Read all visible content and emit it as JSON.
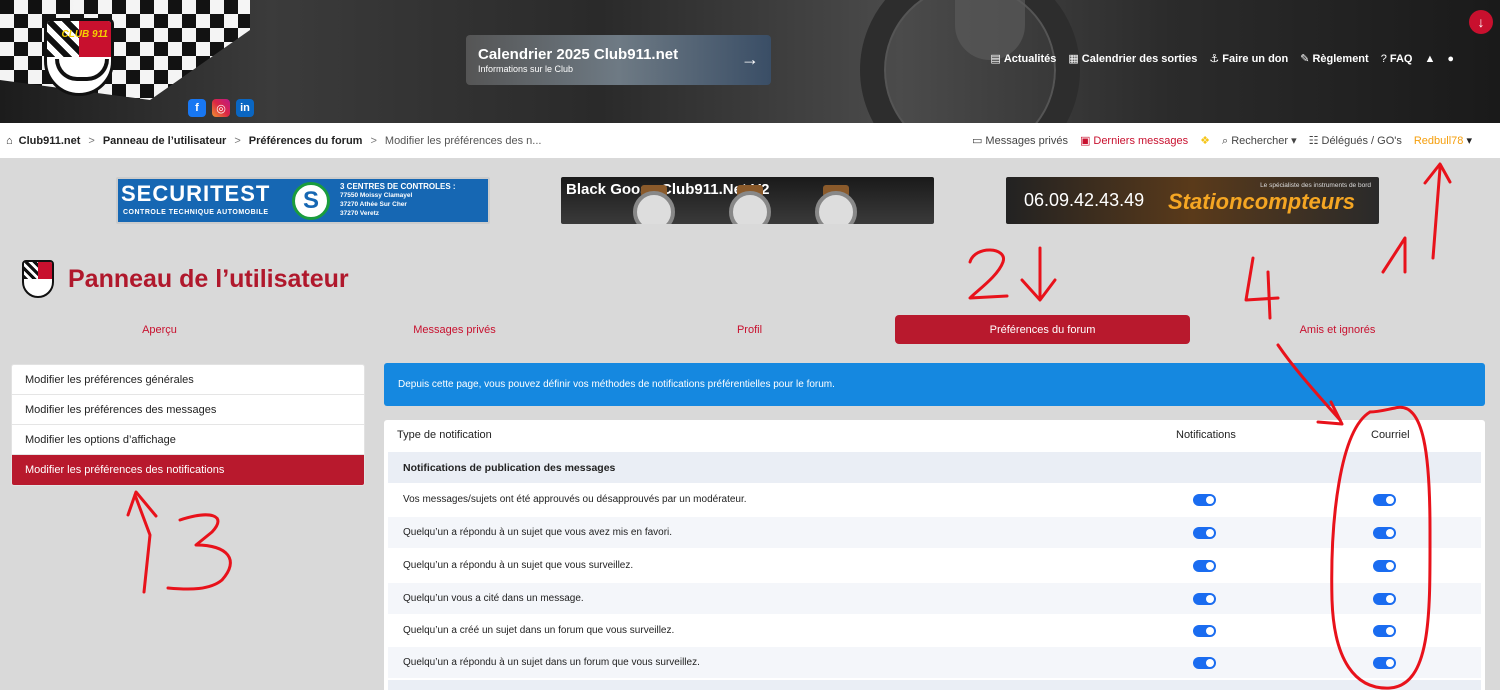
{
  "header": {
    "promo_title": "Calendrier 2025 Club911.net",
    "promo_sub": "Informations sur le Club",
    "crest_text": "CLUB 911",
    "social": [
      "f",
      "◎",
      "in"
    ],
    "nav": [
      {
        "icon": "newspaper-icon",
        "glyph": "▤",
        "label": "Actualités"
      },
      {
        "icon": "calendar-icon",
        "glyph": "▦",
        "label": "Calendrier des sorties"
      },
      {
        "icon": "donate-icon",
        "glyph": "⚓",
        "label": "Faire un don"
      },
      {
        "icon": "rules-icon",
        "glyph": "✎",
        "label": "Règlement"
      },
      {
        "icon": "help-icon",
        "glyph": "?",
        "label": "FAQ"
      }
    ]
  },
  "breadcrumb": {
    "home": "Club911.net",
    "level1": "Panneau de l’utilisateur",
    "level2": "Préférences du forum",
    "current": "Modifier les préférences des n..."
  },
  "usernav": {
    "pm": "Messages privés",
    "latest": "Derniers messages",
    "search": "Rechercher",
    "delegates": "Délégués / GO's",
    "user": "Redbull78"
  },
  "banners": {
    "securitest": "SECURITEST",
    "securitest_sub": "CONTROLE TECHNIQUE AUTOMOBILE",
    "securitest_logo": "S",
    "centres": "3 CENTRES DE CONTROLES :",
    "centre_lines": [
      "77550 Moissy Clamayel",
      "37270 Athée Sur Cher",
      "37270 Veretz"
    ],
    "watch_title": "Black Goose Club911.Net V2",
    "phone": "06.09.42.43.49",
    "brand": "Stationcompteurs",
    "brand_sub": "Le spécialiste des instruments de bord"
  },
  "page_title": "Panneau de l’utilisateur",
  "tabs": [
    "Aperçu",
    "Messages privés",
    "Profil",
    "Préférences du forum",
    "Amis et ignorés"
  ],
  "active_tab": 3,
  "sidebar": [
    "Modifier les préférences générales",
    "Modifier les préférences des messages",
    "Modifier les options d’affichage",
    "Modifier les préférences des notifications"
  ],
  "info": "Depuis cette page, vous pouvez définir vos méthodes de notifications préférentielles pour le forum.",
  "table": {
    "col_type": "Type de notification",
    "col_notif": "Notifications",
    "col_mail": "Courriel",
    "group": "Notifications de publication des messages",
    "rows": [
      {
        "label": "Vos messages/sujets ont été approuvés ou désapprouvés par un modérateur.",
        "notif": true,
        "mail": true
      },
      {
        "label": "Quelqu’un a répondu à un sujet que vous avez mis en favori.",
        "notif": true,
        "mail": true
      },
      {
        "label": "Quelqu’un a répondu à un sujet que vous surveillez.",
        "notif": true,
        "mail": true
      },
      {
        "label": "Quelqu’un vous a cité dans un message.",
        "notif": true,
        "mail": true
      },
      {
        "label": "Quelqu’un a créé un sujet dans un forum que vous surveillez.",
        "notif": true,
        "mail": true
      },
      {
        "label": "Quelqu’un a répondu à un sujet dans un forum que vous surveillez.",
        "notif": true,
        "mail": true
      }
    ]
  },
  "annotations": [
    "1",
    "2",
    "3",
    "4"
  ],
  "colors": {
    "accent": "#b8192d",
    "info": "#1588e0",
    "toggle": "#1a6cf0",
    "user": "#f59e0b",
    "annotation": "#e8121b"
  }
}
